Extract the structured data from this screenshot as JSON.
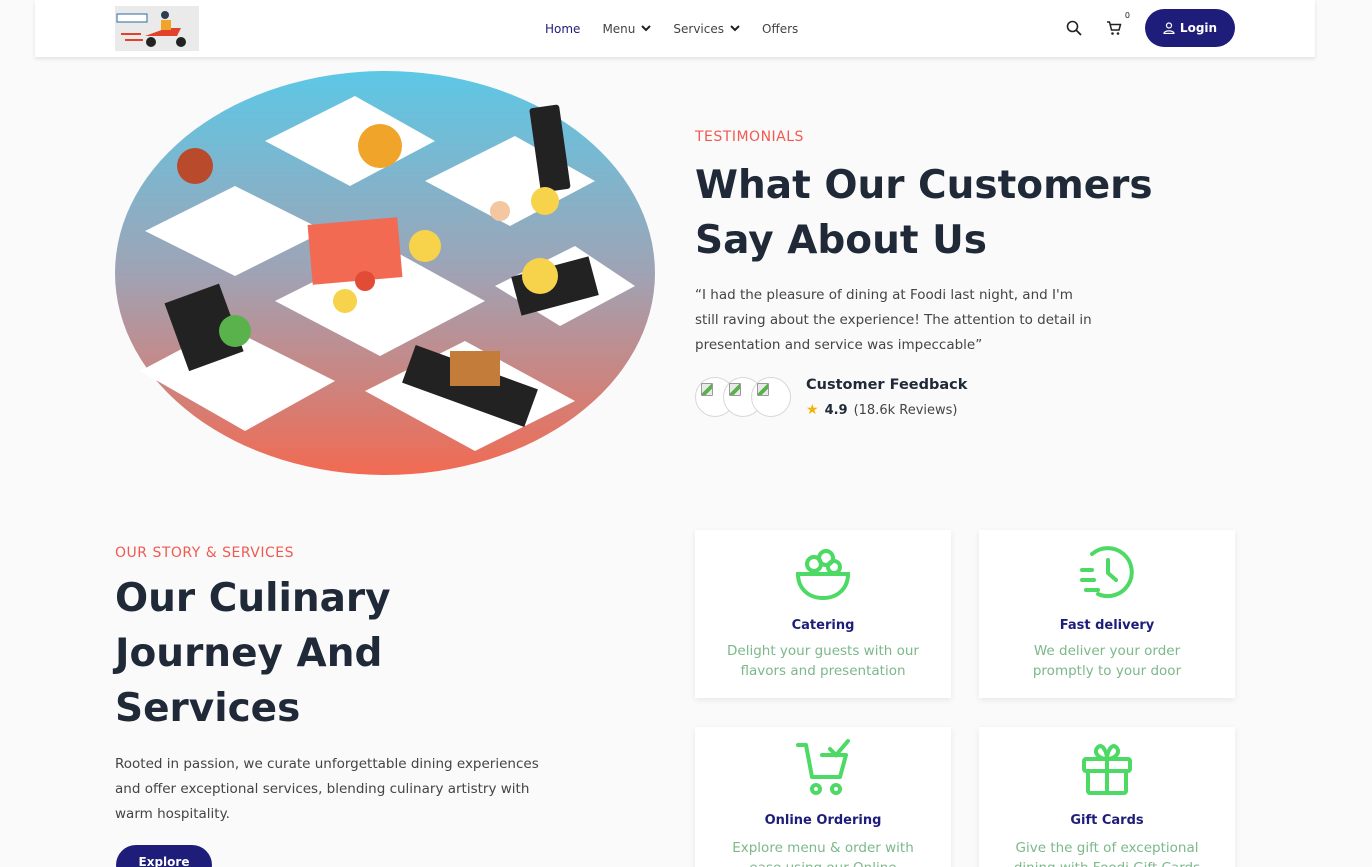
{
  "nav": {
    "links": [
      {
        "label": "Home"
      },
      {
        "label": "Menu"
      },
      {
        "label": "Services"
      },
      {
        "label": "Offers"
      }
    ],
    "cart_count": "0",
    "login_label": "Login"
  },
  "testimonials": {
    "eyebrow": "TESTIMONIALS",
    "title": "What Our Customers Say About Us",
    "quote": "“I had the pleasure of dining at Foodi last night, and I'm still raving about the experience! The attention to detail in presentation and service was impeccable”",
    "feedback_title": "Customer Feedback",
    "rating": "4.9",
    "reviews": "(18.6k Reviews)"
  },
  "story": {
    "eyebrow": "OUR STORY & SERVICES",
    "title": "Our Culinary Journey And Services",
    "body": "Rooted in passion, we curate unforgettable dining experiences and offer exceptional services, blending culinary artistry with warm hospitality.",
    "button_label": "Explore"
  },
  "services": [
    {
      "title": "Catering",
      "desc": "Delight your guests with our flavors and presentation",
      "icon": "salad-bowl-icon"
    },
    {
      "title": "Fast delivery",
      "desc": "We deliver your order promptly to your door",
      "icon": "fast-clock-icon"
    },
    {
      "title": "Online Ordering",
      "desc": "Explore menu & order with ease using our Online Ordering n",
      "icon": "cart-check-icon"
    },
    {
      "title": "Gift Cards",
      "desc": "Give the gift of exceptional dining with Foodi Gift Cards",
      "icon": "gift-icon"
    }
  ],
  "colors": {
    "brand": "#1e1e7a",
    "accent": "#f05a50",
    "icon_green": "#4cd964",
    "desc_green": "#7cb88a"
  }
}
